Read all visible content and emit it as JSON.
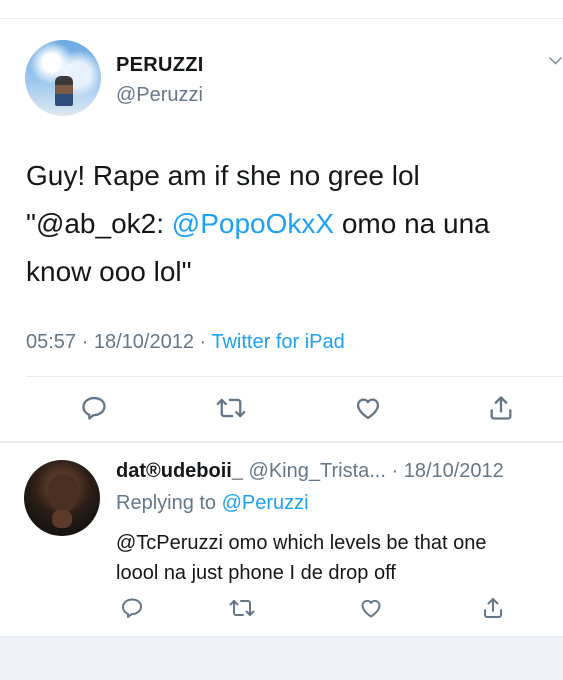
{
  "tweet": {
    "author_name": "PERUZZI",
    "author_handle": "@Peruzzi",
    "text_line1": "Guy! Rape am if she no gree lol",
    "text_quote_open": "\"@ab_ok2: ",
    "text_mention": "@PopoOkxX",
    "text_after_mention": " omo na una",
    "text_line3": "know ooo lol\"",
    "time": "05:57",
    "separator": " · ",
    "date": "18/10/2012",
    "separator2": " · ",
    "source": "Twitter for iPad"
  },
  "reply": {
    "author_name": "dat®udeboii_",
    "author_handle": "@King_Trista...",
    "separator": " · ",
    "date": "18/10/2012",
    "replying_prefix": "Replying to ",
    "replying_to": "@Peruzzi",
    "text_line1": "@TcPeruzzi omo which levels be that one",
    "text_line2": "loool na just phone I de drop off"
  },
  "icons": {
    "reply": "reply-icon",
    "retweet": "retweet-icon",
    "like": "heart-icon",
    "share": "share-icon",
    "more": "chevron-down-icon"
  },
  "colors": {
    "accent": "#1da1f2",
    "secondary_text": "#657786",
    "primary_text": "#14171a",
    "divider": "#e6ecf0"
  }
}
